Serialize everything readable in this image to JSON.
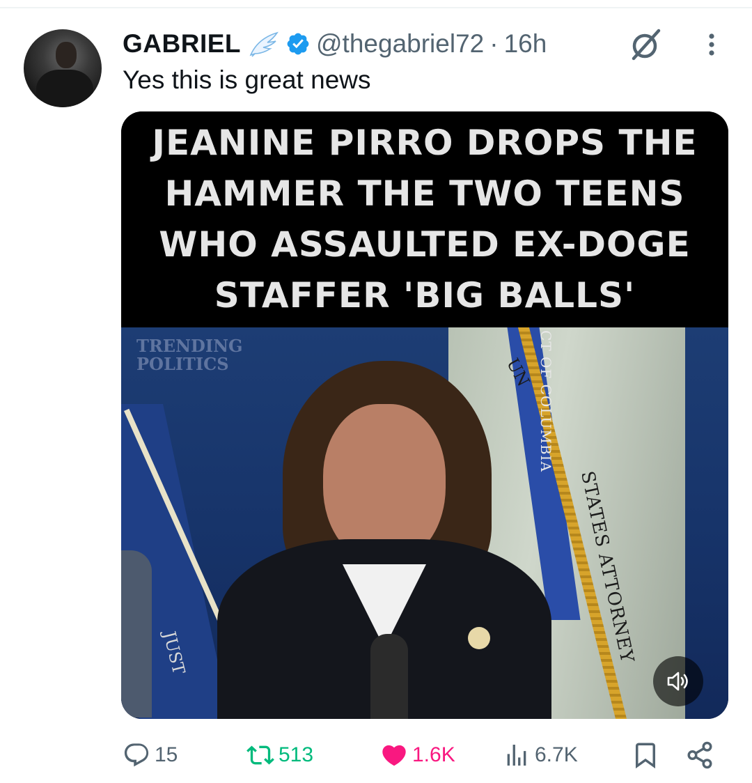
{
  "tweet": {
    "author_name": "GABRIEL",
    "handle": "@thegabriel72",
    "separator": "·",
    "time": "16h",
    "text": "Yes this is great news"
  },
  "media": {
    "caption": "JEANINE PIRRO DROPS THE HAMMER THE TWO TEENS WHO ASSAULTED EX-DOGE STAFFER 'BIG BALLS'",
    "watermark_line1": "TRENDING",
    "watermark_line2": "POLITICS",
    "flag_text_1": "CT OF COLUMBIA",
    "flag_text_2": "STATES ATTORNEY",
    "flag_text_3": "UN",
    "flag_text_4": "JUST"
  },
  "actions": {
    "replies": "15",
    "reposts": "513",
    "likes": "1.6K",
    "views": "6.7K"
  },
  "colors": {
    "verified": "#1d9bf0",
    "repost": "#00ba7c",
    "like": "#f91880",
    "muted_text": "#536471"
  }
}
